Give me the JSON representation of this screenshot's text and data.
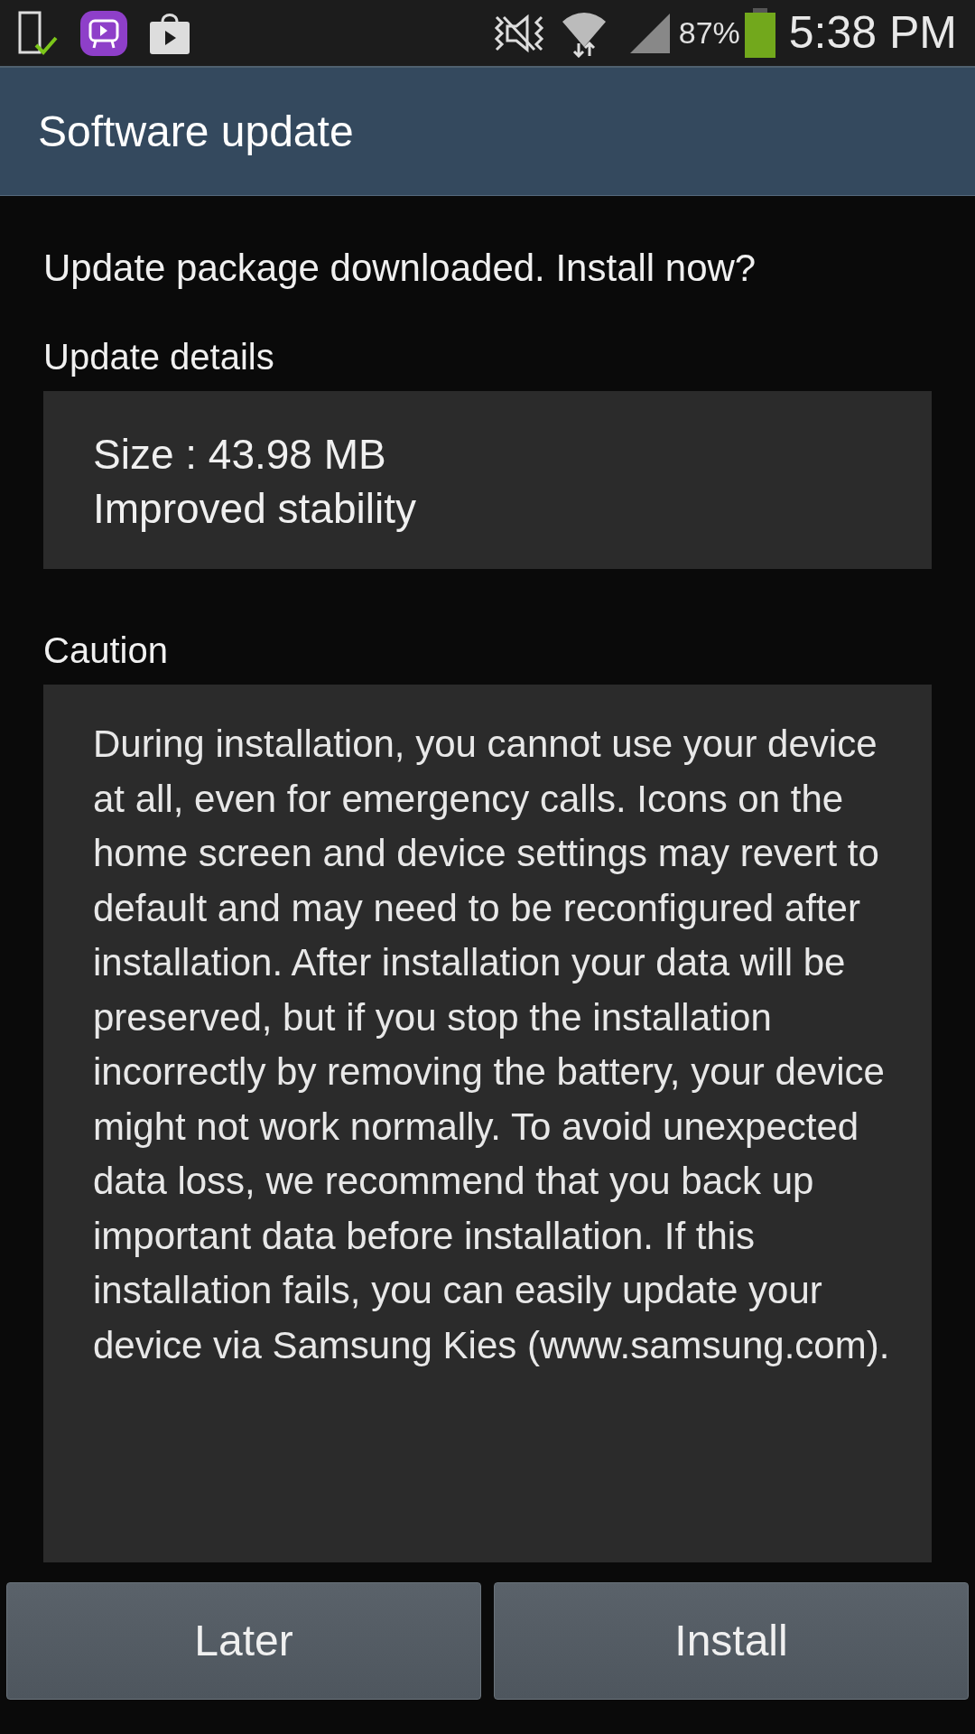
{
  "status_bar": {
    "battery_percent": "87%",
    "time": "5:38 PM"
  },
  "title_bar": {
    "title": "Software update"
  },
  "prompt": "Update package downloaded. Install now?",
  "details": {
    "heading": "Update details",
    "lines": [
      "Size : 43.98 MB",
      "Improved stability"
    ]
  },
  "caution": {
    "heading": "Caution",
    "text": "During installation, you cannot use your device at all, even for emergency calls. Icons on the home screen and device settings may revert to default and may need to be reconfigured after installation. After installation your data will be preserved, but if you stop the installation incorrectly by removing the battery, your device might not work normally. To avoid unexpected data loss, we recommend that you back up important data before installation. If this installation fails, you can easily update your device via Samsung Kies (www.samsung.com)."
  },
  "buttons": [
    "Later",
    "Install"
  ]
}
